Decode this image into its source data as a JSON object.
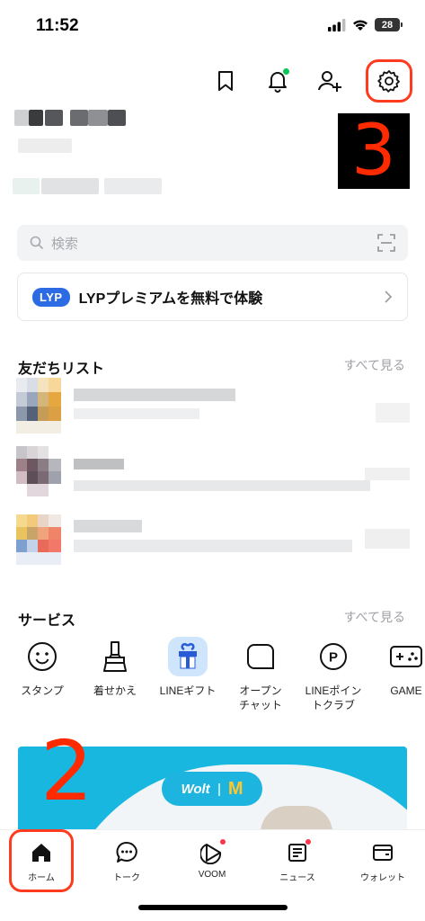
{
  "status": {
    "time": "11:52",
    "battery": "28"
  },
  "header": {
    "icons": [
      "bookmark-icon",
      "bell-icon",
      "add-friend-icon",
      "gear-icon"
    ]
  },
  "annotations": {
    "step3": "3",
    "step2": "2"
  },
  "search": {
    "placeholder": "検索"
  },
  "promo": {
    "logo": "LYP",
    "text": "LYPプレミアムを無料で体験"
  },
  "friends": {
    "title": "友だちリスト",
    "see_all": "すべて見る"
  },
  "services": {
    "title": "サービス",
    "see_all": "すべて見る",
    "items": [
      {
        "label": "スタンプ",
        "icon": "smile-icon"
      },
      {
        "label": "着せかえ",
        "icon": "brush-icon"
      },
      {
        "label": "LINEギフト",
        "icon": "gift-icon"
      },
      {
        "label": "オープン\nチャット",
        "icon": "open-chat-icon"
      },
      {
        "label": "LINEポイン\nトクラブ",
        "icon": "points-icon"
      },
      {
        "label": "GAME",
        "icon": "game-icon"
      }
    ]
  },
  "banner": {
    "brand1": "Wolt",
    "brand2": "M"
  },
  "tabs": [
    {
      "label": "ホーム",
      "icon": "home-icon"
    },
    {
      "label": "トーク",
      "icon": "chat-icon"
    },
    {
      "label": "VOOM",
      "icon": "voom-icon"
    },
    {
      "label": "ニュース",
      "icon": "news-icon"
    },
    {
      "label": "ウォレット",
      "icon": "wallet-icon"
    }
  ],
  "colors": {
    "accent": "#06c755",
    "annotation": "#ff3b1f",
    "lyp": "#2d6be4",
    "banner": "#18b7e0"
  }
}
